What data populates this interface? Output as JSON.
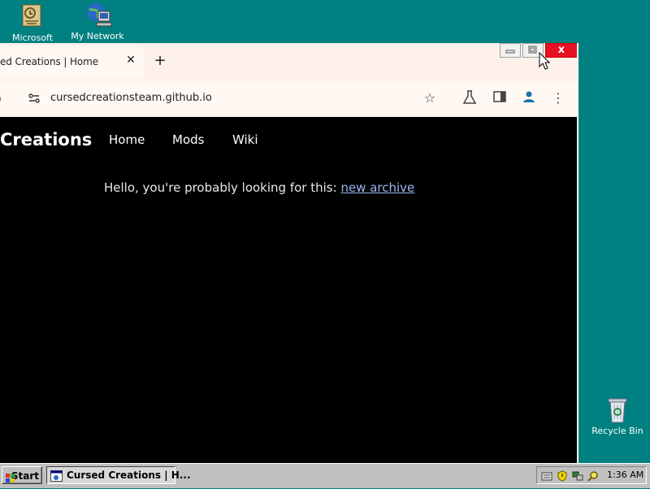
{
  "desktop": {
    "icons": [
      {
        "label": "Microsoft"
      },
      {
        "label": "My Network"
      },
      {
        "label": "Recycle Bin"
      }
    ]
  },
  "browser": {
    "tab": {
      "title": "ed Creations | Home"
    },
    "address": {
      "url": "cursedcreationsteam.github.io"
    },
    "window_controls": {
      "close_symbol": "x"
    }
  },
  "page": {
    "brand": "Creations",
    "nav": [
      "Home",
      "Mods",
      "Wiki"
    ],
    "message": "Hello, you're probably looking for this:",
    "link": "new archive"
  },
  "taskbar": {
    "start_label": "Start",
    "window_button": "Cursed Creations | H...",
    "clock": "1:36 AM"
  },
  "colors": {
    "desktop": "#008080",
    "page_background": "#000000",
    "link": "#9ab8f0",
    "close_button": "#e81123"
  }
}
